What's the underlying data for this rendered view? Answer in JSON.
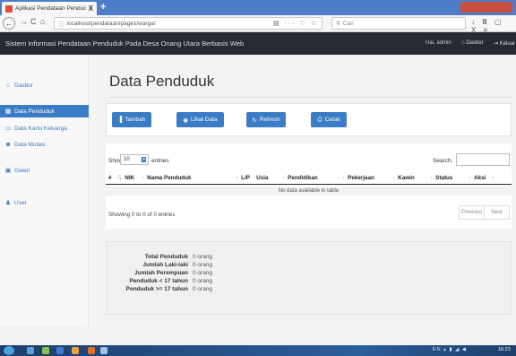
{
  "browser": {
    "tab_title": "Aplikasi Pendataan Penduduk",
    "tab_close": "X",
    "new_tab": "+",
    "url": "localhost/pendataan/pages/warga/",
    "search_placeholder": "Cari"
  },
  "app": {
    "title": "Sistem Informasi Pendataan Penduduk Pada Desa Onang Utara Berbasis Web",
    "greeting": "Hai, admin",
    "nav_dasbor": "Dasbor",
    "nav_keluar": "Keluar"
  },
  "sidebar": {
    "items": [
      {
        "label": "Dasbor",
        "icon": "home-icon"
      },
      {
        "label": "Data Penduduk",
        "icon": "table-icon",
        "active": true
      },
      {
        "label": "Data Kartu Keluarga",
        "icon": "card-icon"
      },
      {
        "label": "Data Mutasi",
        "icon": "users-icon"
      },
      {
        "label": "Galeri",
        "icon": "image-icon"
      },
      {
        "label": "User",
        "icon": "user-icon"
      }
    ]
  },
  "page": {
    "title": "Data Penduduk"
  },
  "toolbar": {
    "tambah": "Tambah",
    "lihat_data": "Lihat Data",
    "refresh": "Refresh",
    "cetak": "Cetak"
  },
  "table": {
    "show_label": "Show",
    "page_size": "10",
    "entries_label": "entries",
    "search_label": "Search:",
    "columns": [
      "#",
      "NIK",
      "Nama Penduduk",
      "L/P",
      "Usia",
      "Pendidikan",
      "Pekerjaan",
      "Kawin",
      "Status",
      "Aksi"
    ],
    "empty_message": "No data available in table",
    "info": "Showing 0 to 0 of 0 entries",
    "previous": "Previous",
    "next": "Next"
  },
  "summary": {
    "rows": [
      {
        "label": "Total Penduduk",
        "value": "0 orang"
      },
      {
        "label": "Jumlah Laki-laki",
        "value": "0 orang"
      },
      {
        "label": "Jumlah Perempuan",
        "value": "0 orang"
      },
      {
        "label": "Penduduk < 17 tahun",
        "value": "0 orang"
      },
      {
        "label": "Penduduk >= 17 tahun",
        "value": "0 orang"
      }
    ]
  },
  "taskbar": {
    "tray": "EN",
    "clock": "16:23"
  },
  "colors": {
    "accent": "#3a7cc6",
    "header_bg": "#252a33",
    "browser_chrome": "#4f7ec9"
  }
}
